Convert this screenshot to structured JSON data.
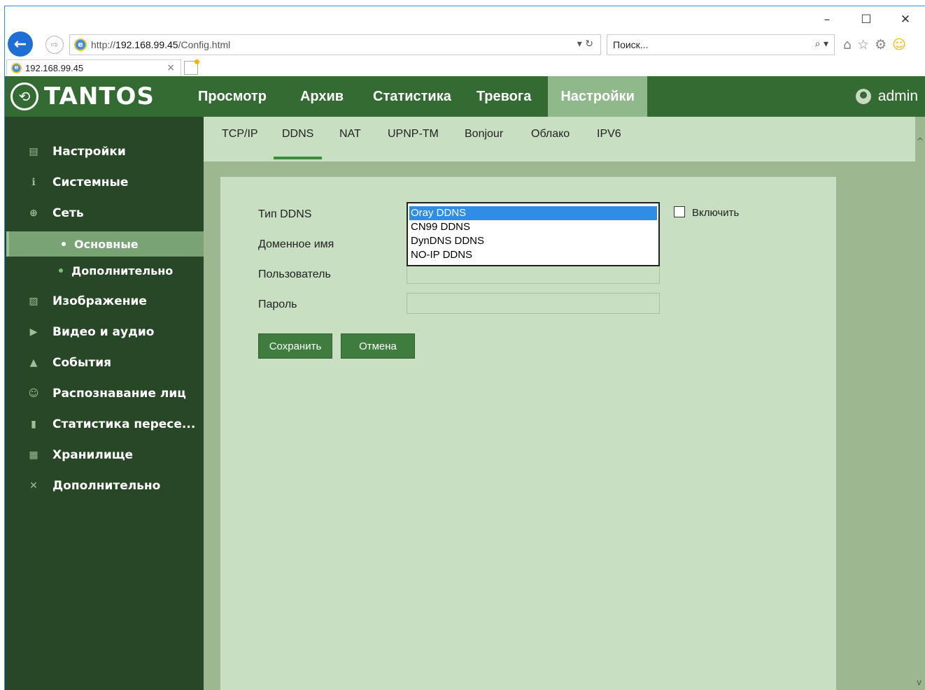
{
  "browser": {
    "controls": {
      "minimize": "–",
      "maximize": "☐",
      "close": "✕"
    },
    "back_glyph": "←",
    "forward_glyph": "⇨",
    "address": {
      "prefix": "http://",
      "host": "192.168.99.45",
      "path": "/Config.html",
      "tail": "▾ ↻"
    },
    "search": {
      "placeholder": "Поиск...",
      "tail": "⌕ ▾"
    },
    "tool_icons": [
      "⌂",
      "☆",
      "⚙",
      "☺"
    ],
    "tab": {
      "title": "192.168.99.45",
      "close": "×"
    }
  },
  "app": {
    "logo": {
      "mark": "⟲",
      "text": "TANTOS"
    },
    "menu": [
      {
        "label": "Просмотр",
        "active": false
      },
      {
        "label": "Архив",
        "active": false
      },
      {
        "label": "Статистика",
        "active": false
      },
      {
        "label": "Тревога",
        "active": false
      },
      {
        "label": "Настройки",
        "active": true
      }
    ],
    "user": "admin",
    "sidebar": {
      "items": [
        {
          "label": "Настройки",
          "icon": "monitor-icon",
          "glyph": "▤"
        },
        {
          "label": "Системные",
          "icon": "info-icon",
          "glyph": "ℹ"
        },
        {
          "label": "Сеть",
          "icon": "globe-icon",
          "glyph": "⊕"
        },
        {
          "label": "Изображение",
          "icon": "image-icon",
          "glyph": "▨"
        },
        {
          "label": "Видео и аудио",
          "icon": "video-icon",
          "glyph": "▶"
        },
        {
          "label": "События",
          "icon": "bell-icon",
          "glyph": "▲"
        },
        {
          "label": "Распознавание лиц",
          "icon": "face-icon",
          "glyph": "☺"
        },
        {
          "label": "Статистика пересе...",
          "icon": "bar-chart-icon",
          "glyph": "▮"
        },
        {
          "label": "Хранилище",
          "icon": "storage-icon",
          "glyph": "▦"
        },
        {
          "label": "Дополнительно",
          "icon": "tools-icon",
          "glyph": "✕"
        }
      ],
      "subitems": [
        {
          "label": "Основные",
          "active": true
        },
        {
          "label": "Дополнительно",
          "active": false
        }
      ]
    },
    "subtabs": [
      "TCP/IP",
      "DDNS",
      "NAT",
      "UPNP-TM",
      "Bonjour",
      "Облако",
      "IPV6"
    ],
    "active_subtab": "DDNS",
    "form": {
      "labels": {
        "ddns_type": "Тип DDNS",
        "domain": "Доменное имя",
        "user": "Пользователь",
        "password": "Пароль"
      },
      "ddns_options": [
        "Oray DDNS",
        "CN99 DDNS",
        "DynDNS DDNS",
        "NO-IP DDNS"
      ],
      "selected_option": "Oray DDNS",
      "enable_label": "Включить",
      "enable_checked": false,
      "save": "Сохранить",
      "cancel": "Отмена"
    }
  }
}
